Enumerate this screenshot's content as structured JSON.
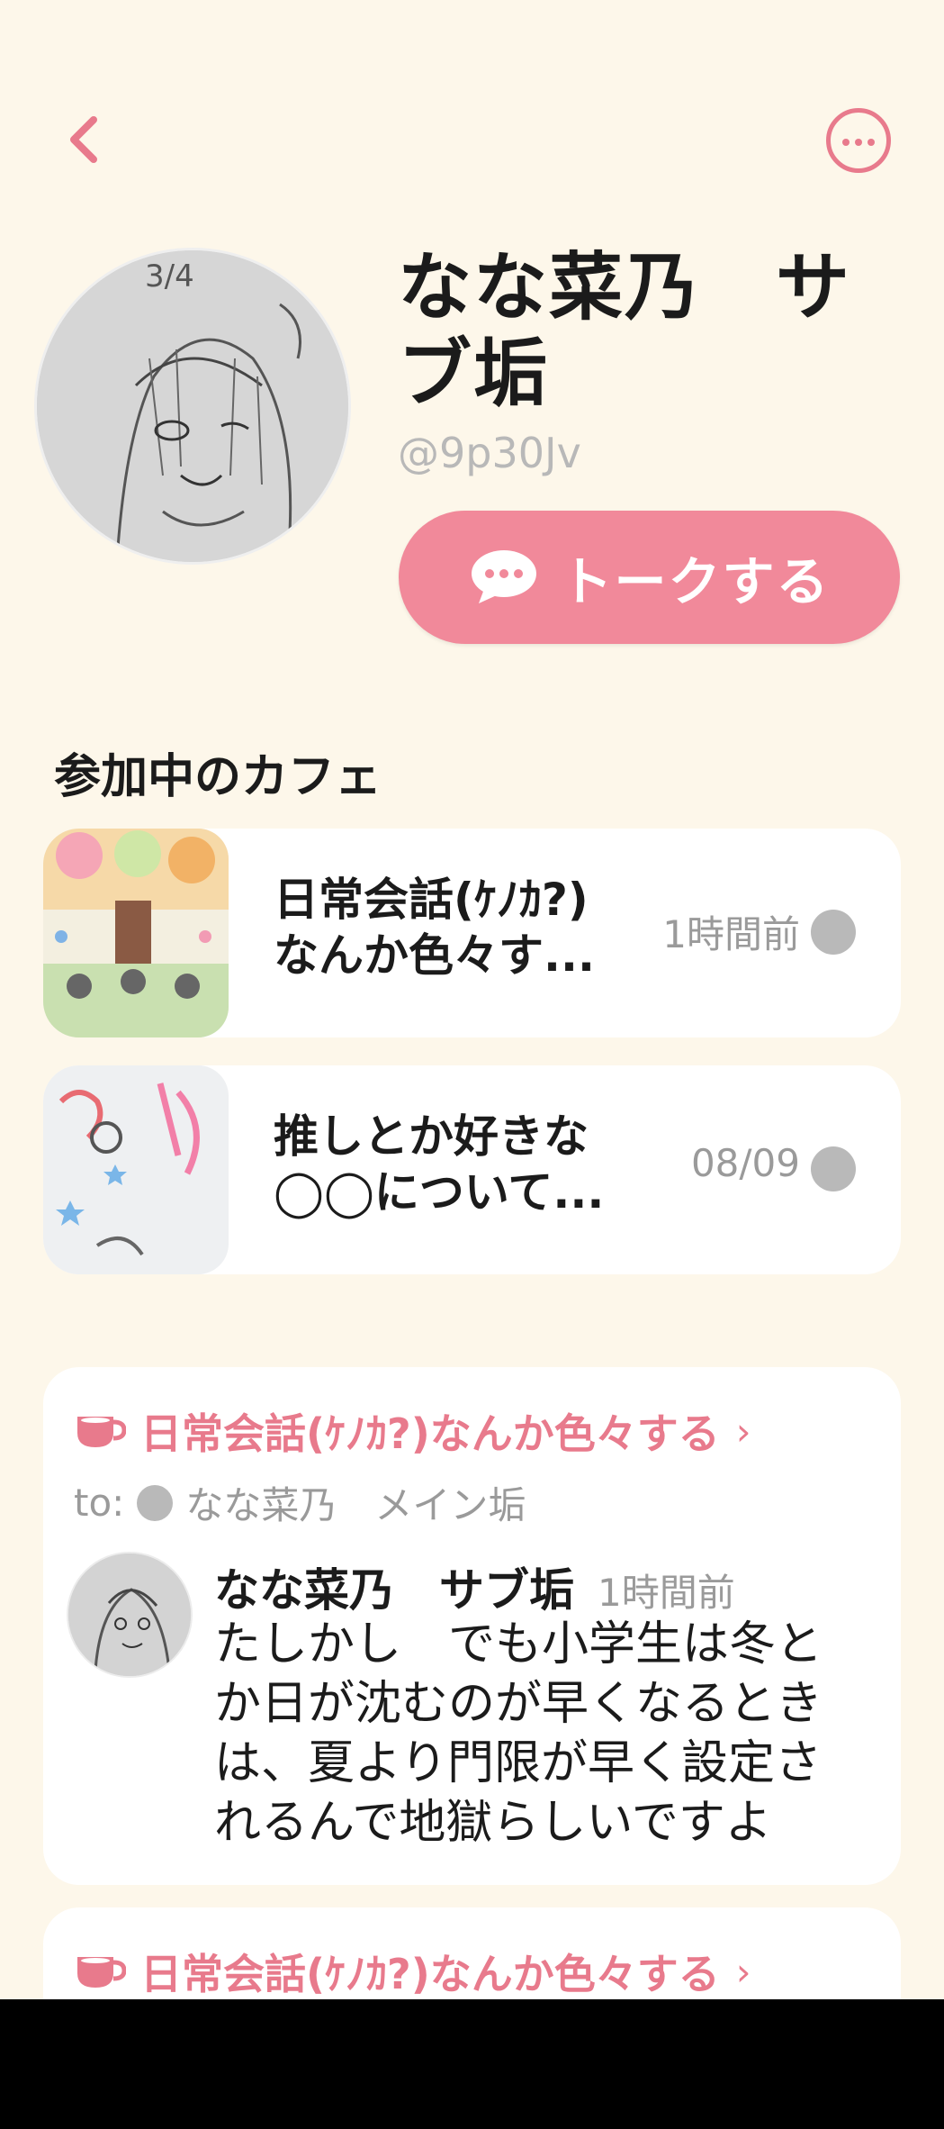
{
  "header": {
    "back_icon": "chevron-left-icon",
    "more_icon": "more-horizontal-icon"
  },
  "profile": {
    "name": "なな菜乃　サブ垢",
    "handle": "@9p30Jv",
    "talk_button_label": "トークする"
  },
  "cafes_section": {
    "title": "参加中のカフェ",
    "items": [
      {
        "title_line1": "日常会話(ｹﾉｶ?)",
        "title_line2": "なんか色々す...",
        "time": "1時間前"
      },
      {
        "title_line1": "推しとか好きな",
        "title_line2": "◯◯について...",
        "time": "08/09"
      }
    ]
  },
  "posts": [
    {
      "cafe_name": "日常会話(ｹﾉｶ?)なんか色々する",
      "to_label": "to:",
      "to_name": "なな菜乃　メイン垢",
      "author": "なな菜乃　サブ垢",
      "time": "1時間前",
      "body_lines": [
        "たしかし　でも小学生は冬と",
        "か日が沈むのが早くなるとき",
        "は、夏より門限が早く設定さ",
        "れるんで地獄らしいですよ"
      ]
    },
    {
      "cafe_name": "日常会話(ｹﾉｶ?)なんか色々する"
    }
  ],
  "colors": {
    "background": "#fdf7ea",
    "accent": "#e87a8c",
    "button": "#f1899a"
  }
}
